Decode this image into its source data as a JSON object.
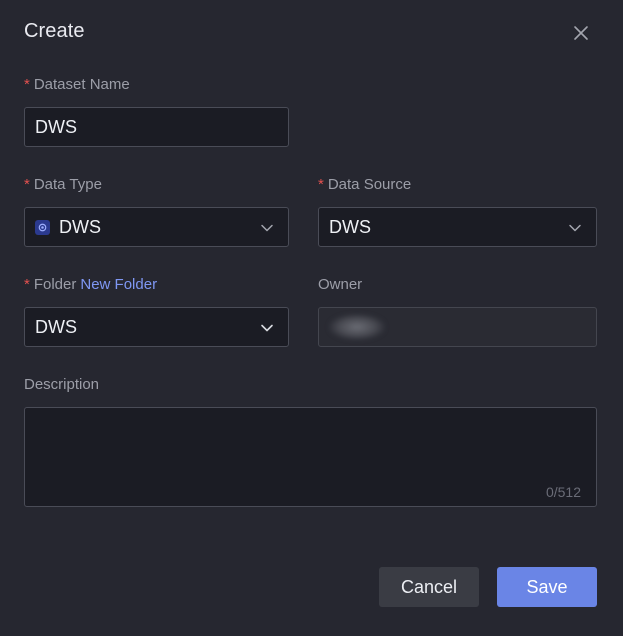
{
  "dialog": {
    "title": "Create",
    "close_icon": "close-icon"
  },
  "form": {
    "dataset_name": {
      "label": "Dataset Name",
      "required": "*",
      "value": "DWS"
    },
    "data_type": {
      "label": "Data Type",
      "required": "*",
      "value": "DWS",
      "icon": "dws-icon"
    },
    "data_source": {
      "label": "Data Source",
      "required": "*",
      "value": "DWS"
    },
    "folder": {
      "label": "Folder",
      "required": "*",
      "link": "New Folder",
      "value": "DWS"
    },
    "owner": {
      "label": "Owner"
    },
    "description": {
      "label": "Description",
      "counter": "0/512"
    }
  },
  "footer": {
    "cancel_label": "Cancel",
    "save_label": "Save"
  },
  "colors": {
    "background": "#262730",
    "accent": "#6a85e6",
    "link": "#7f97f3",
    "required": "#e4514f"
  }
}
